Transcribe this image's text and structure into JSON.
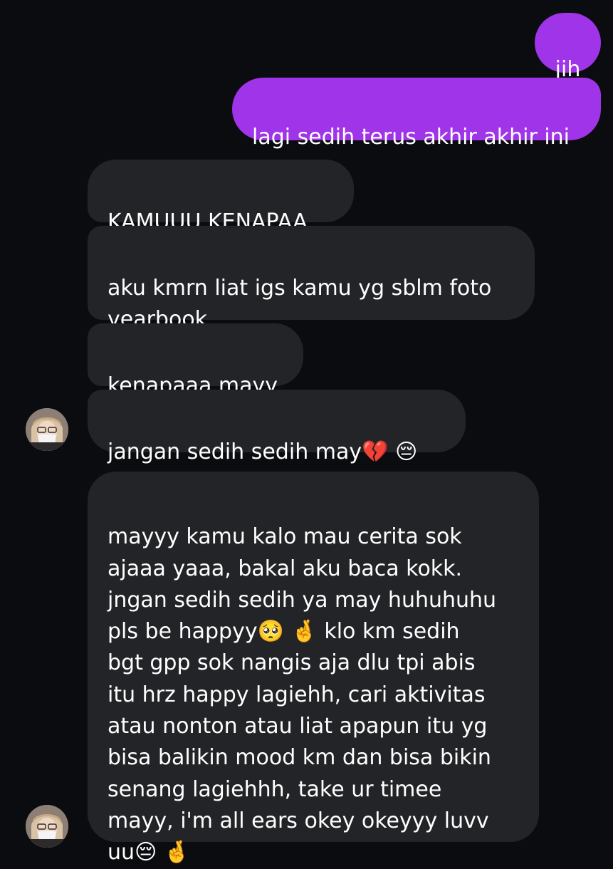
{
  "conversation": {
    "sent_messages": [
      "jih",
      "lagi sedih terus akhir akhir ini"
    ],
    "received_messages": [
      "KAMUUU KENAPAA",
      "aku kmrn liat igs kamu yg sblm foto\nyearbook",
      "kenapaaa mayy",
      "jangan sedih sedih may💔 😔",
      "mayyy kamu kalo mau cerita sok\najaaa yaaa, bakal aku baca kokk.\njngan sedih sedih ya may huhuhuhu\npls be happyy🥺 🤞  klo km sedih\nbgt gpp sok nangis aja dlu tpi abis\nitu hrz happy lagiehh, cari aktivitas\natau nonton atau liat apapun itu yg\nbisa balikin mood km dan bisa bikin\nsenang lagiehhh, take ur timee\nmayy, i'm all ears okey okeyyy luvv\nuu😔 🤞"
    ]
  },
  "colors": {
    "background": "#0b0c0f",
    "sent_bubble": "#a034e8",
    "received_bubble": "#232427",
    "text": "#ffffff"
  },
  "icons": {
    "avatar": "profile-photo-avatar"
  }
}
